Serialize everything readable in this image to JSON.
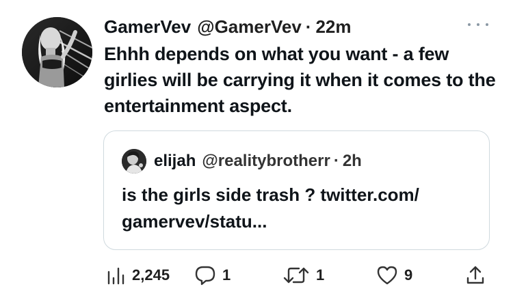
{
  "tweet": {
    "display_name": "GamerVev",
    "handle": "@GamerVev",
    "separator": "·",
    "time": "22m",
    "text": "Ehhh depends on what you want - a few girlies will be carrying it when it comes to the entertainment aspect."
  },
  "quoted_tweet": {
    "display_name": "elijah",
    "handle": "@realitybrotherr",
    "separator": "·",
    "time": "2h",
    "text": "is the girls side trash ? twitter.com/ gamervev/statu..."
  },
  "actions": {
    "views": "2,245",
    "replies": "1",
    "retweets": "1",
    "likes": "9"
  },
  "icons": {
    "more": "more-icon",
    "views": "views-icon",
    "reply": "reply-icon",
    "retweet": "retweet-icon",
    "like": "like-icon",
    "share": "share-icon"
  }
}
